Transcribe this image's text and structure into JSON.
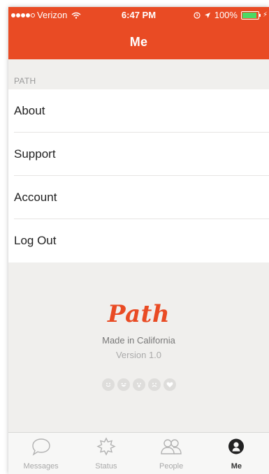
{
  "status_bar": {
    "carrier": "Verizon",
    "time": "6:47 PM",
    "battery": "100%",
    "battery_level": 1.0,
    "signal_bars_filled": 4,
    "signal_bars_total": 5
  },
  "nav": {
    "title": "Me"
  },
  "section": {
    "header": "PATH"
  },
  "menu": {
    "items": [
      {
        "label": "About"
      },
      {
        "label": "Support"
      },
      {
        "label": "Account"
      },
      {
        "label": "Log Out"
      }
    ]
  },
  "brand": {
    "logo": "Path",
    "made_in": "Made in California",
    "version": "Version 1.0"
  },
  "emotions": [
    "happy-emotion-icon",
    "laugh-emotion-icon",
    "surprise-emotion-icon",
    "sad-emotion-icon",
    "love-emotion-icon"
  ],
  "tabbar": {
    "tabs": [
      {
        "label": "Messages",
        "icon": "messages-icon",
        "active": false
      },
      {
        "label": "Status",
        "icon": "status-icon",
        "active": false
      },
      {
        "label": "People",
        "icon": "people-icon",
        "active": false
      },
      {
        "label": "Me",
        "icon": "me-icon",
        "active": true
      }
    ]
  },
  "colors": {
    "brand": "#e94b24",
    "battery": "#4cd964",
    "background": "#f0efed"
  }
}
